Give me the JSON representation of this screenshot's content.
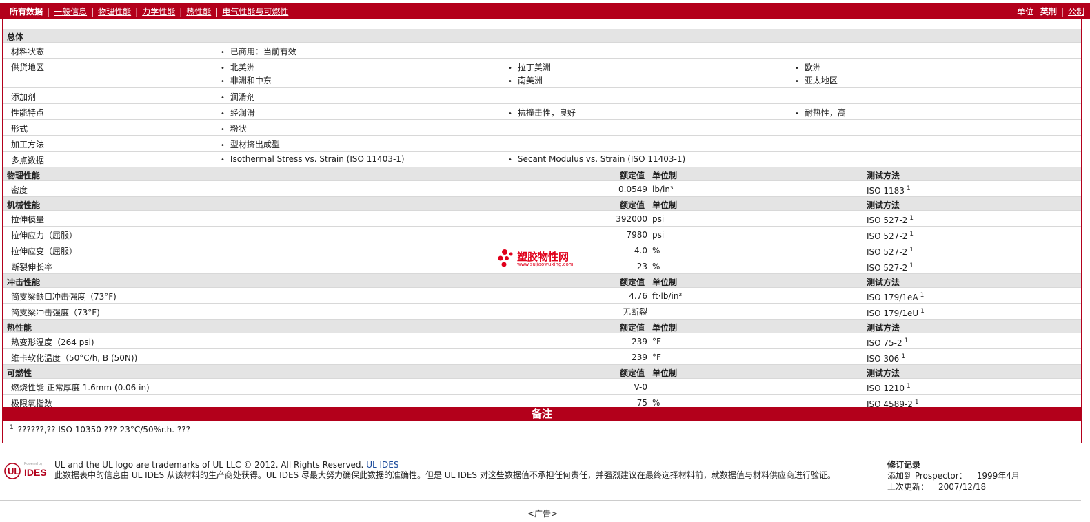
{
  "nav": {
    "tabs": [
      "所有数据",
      "一般信息",
      "物理性能",
      "力学性能",
      "热性能",
      "电气性能与可燃性"
    ],
    "unit_label": "单位",
    "unit_imperial": "英制",
    "unit_metric": "公制"
  },
  "general": {
    "header": "总体",
    "rows": [
      {
        "label": "材料状态",
        "items": [
          "已商用：当前有效"
        ]
      },
      {
        "label": "供货地区",
        "items": [
          "北美洲",
          "拉丁美洲",
          "欧洲",
          "非洲和中东",
          "南美洲",
          "亚太地区"
        ]
      },
      {
        "label": "添加剂",
        "items": [
          "润滑剂"
        ]
      },
      {
        "label": "性能特点",
        "items": [
          "经润滑",
          "抗撞击性，良好",
          "耐热性，高"
        ]
      },
      {
        "label": "形式",
        "items": [
          "粉状"
        ]
      },
      {
        "label": "加工方法",
        "items": [
          "型材挤出成型"
        ]
      },
      {
        "label": "多点数据",
        "items": [
          "Isothermal Stress vs. Strain (ISO 11403-1)",
          "Secant Modulus vs. Strain (ISO 11403-1)"
        ]
      }
    ]
  },
  "col_headers": {
    "rated": "额定值",
    "unit": "单位制",
    "method": "测试方法"
  },
  "sections": [
    {
      "header": "物理性能",
      "rows": [
        {
          "label": "密度",
          "value": "0.0549",
          "unit": "lb/in³",
          "method": "ISO 1183",
          "sup": "1"
        }
      ]
    },
    {
      "header": "机械性能",
      "rows": [
        {
          "label": "拉伸模量",
          "value": "392000",
          "unit": "psi",
          "method": "ISO 527-2",
          "sup": "1"
        },
        {
          "label": "拉伸应力（屈服）",
          "value": "7980",
          "unit": "psi",
          "method": "ISO 527-2",
          "sup": "1"
        },
        {
          "label": "拉伸应变（屈服）",
          "value": "4.0",
          "unit": "%",
          "method": "ISO 527-2",
          "sup": "1"
        },
        {
          "label": "断裂伸长率",
          "value": "23",
          "unit": "%",
          "method": "ISO 527-2",
          "sup": "1"
        }
      ]
    },
    {
      "header": "冲击性能",
      "rows": [
        {
          "label": "简支梁缺口冲击强度（73°F)",
          "value": "4.76",
          "unit": "ft·lb/in²",
          "method": "ISO 179/1eA",
          "sup": "1"
        },
        {
          "label": "简支梁冲击强度（73°F)",
          "value": "无断裂",
          "unit": "",
          "method": "ISO 179/1eU",
          "sup": "1"
        }
      ]
    },
    {
      "header": "热性能",
      "rows": [
        {
          "label": "热变形温度（264 psi)",
          "value": "239",
          "unit": "°F",
          "method": "ISO 75-2",
          "sup": "1"
        },
        {
          "label": "维卡软化温度（50°C/h, B (50N))",
          "value": "239",
          "unit": "°F",
          "method": "ISO 306",
          "sup": "1"
        }
      ]
    },
    {
      "header": "可燃性",
      "rows": [
        {
          "label": "燃烧性能 正常厚度 1.6mm (0.06 in)",
          "value": "V-0",
          "unit": "",
          "method": "ISO 1210",
          "sup": "1"
        },
        {
          "label": "极限氧指数",
          "value": "75",
          "unit": "%",
          "method": "ISO 4589-2",
          "sup": "1"
        }
      ]
    }
  ],
  "notes": {
    "header": "备注",
    "sup": "1",
    "text": "??????,?? ISO 10350 ??? 23°C/50%r.h. ???"
  },
  "footer": {
    "logo_top": "Powered by",
    "logo_main": "IDES",
    "line1_prefix": "UL and the UL logo are trademarks of UL LLC © 2012. All Rights Reserved.",
    "line1_link": "UL IDES",
    "line2": "此数据表中的信息由 UL IDES 从该材料的生产商处获得。UL IDES 尽最大努力确保此数据的准确性。但是 UL IDES 对这些数据值不承担任何责任，并强烈建议在最终选择材料前，就数据值与材料供应商进行验证。",
    "rev_header": "修订记录",
    "rev_added_label": "添加到 Prospector：",
    "rev_added_value": "1999年4月",
    "rev_updated_label": "上次更新：",
    "rev_updated_value": "2007/12/18"
  },
  "ad": "<广告>",
  "watermark": {
    "cn": "塑胶物性网",
    "url": "www.sujiaowuxing.com"
  }
}
